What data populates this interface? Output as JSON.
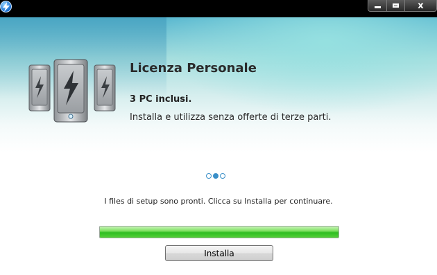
{
  "titlebar": {
    "app_icon": "lightning-app-icon",
    "controls": {
      "minimize": "minimize-icon",
      "maximize": "maximize-icon",
      "close_label": "x"
    }
  },
  "banner": {
    "illustration": "server-towers-lightning-icon",
    "headline": "Licenza Personale",
    "pcs_included": "3 PC inclusi.",
    "description": "Installa e utilizza senza offerte di terze parti."
  },
  "step_indicator": {
    "total": 3,
    "active_index": 1
  },
  "status_message": "I files di setup sono pronti. Clicca su Installa per continuare.",
  "progress": {
    "fraction": 1.0,
    "color": "#3cc52a"
  },
  "install_button": {
    "label": "Installa"
  }
}
